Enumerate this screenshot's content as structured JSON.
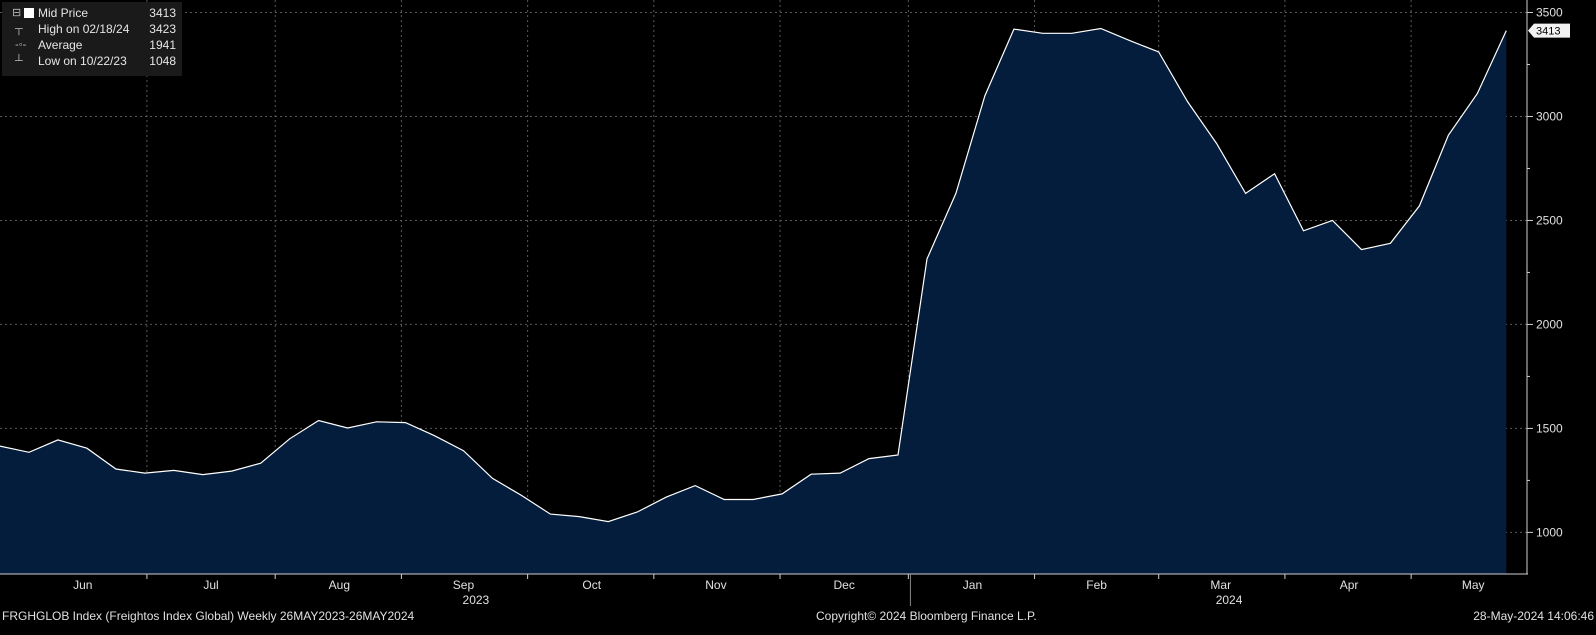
{
  "chart_data": {
    "type": "area",
    "title": "",
    "xlabel": "",
    "ylabel": "",
    "ylim": [
      800,
      3560
    ],
    "xlim": [
      "2023-05-26",
      "2024-05-29"
    ],
    "y_ticks": [
      1000,
      1500,
      2000,
      2500,
      3000,
      3500
    ],
    "x_ticks": [
      {
        "label": "Jun",
        "date": "2023-06-15"
      },
      {
        "label": "Jul",
        "date": "2023-07-16"
      },
      {
        "label": "Aug",
        "date": "2023-08-16"
      },
      {
        "label": "Sep",
        "date": "2023-09-15"
      },
      {
        "label": "Oct",
        "date": "2023-10-16"
      },
      {
        "label": "Nov",
        "date": "2023-11-15"
      },
      {
        "label": "Dec",
        "date": "2023-12-16"
      },
      {
        "label": "Jan",
        "date": "2024-01-16"
      },
      {
        "label": "Feb",
        "date": "2024-02-15"
      },
      {
        "label": "Mar",
        "date": "2024-03-16"
      },
      {
        "label": "Apr",
        "date": "2024-04-16"
      },
      {
        "label": "May",
        "date": "2024-05-16"
      }
    ],
    "year_labels": [
      {
        "label": "2023",
        "date": "2023-09-18"
      },
      {
        "label": "2024",
        "date": "2024-03-18"
      }
    ],
    "grid": true,
    "line_color": "#ffffff",
    "fill_color": "#041d3c",
    "series": [
      {
        "x": [
          "2023-05-26",
          "2023-06-02",
          "2023-06-09",
          "2023-06-16",
          "2023-06-23",
          "2023-06-30",
          "2023-07-07",
          "2023-07-14",
          "2023-07-21",
          "2023-07-28",
          "2023-08-04",
          "2023-08-11",
          "2023-08-18",
          "2023-08-25",
          "2023-09-01",
          "2023-09-08",
          "2023-09-15",
          "2023-09-22",
          "2023-09-29",
          "2023-10-06",
          "2023-10-13",
          "2023-10-20",
          "2023-10-27",
          "2023-11-03",
          "2023-11-10",
          "2023-11-17",
          "2023-11-24",
          "2023-12-01",
          "2023-12-08",
          "2023-12-15",
          "2023-12-22",
          "2023-12-29",
          "2024-01-05",
          "2024-01-12",
          "2024-01-19",
          "2024-01-26",
          "2024-02-02",
          "2024-02-09",
          "2024-02-16",
          "2024-02-23",
          "2024-03-01",
          "2024-03-08",
          "2024-03-15",
          "2024-03-22",
          "2024-03-29",
          "2024-04-05",
          "2024-04-12",
          "2024-04-19",
          "2024-04-26",
          "2024-05-03",
          "2024-05-10",
          "2024-05-17",
          "2024-05-24"
        ],
        "y": [
          1415,
          1385,
          1445,
          1405,
          1305,
          1285,
          1298,
          1278,
          1295,
          1333,
          1450,
          1538,
          1502,
          1532,
          1528,
          1465,
          1393,
          1260,
          1178,
          1088,
          1076,
          1052,
          1098,
          1170,
          1225,
          1158,
          1158,
          1185,
          1280,
          1285,
          1355,
          1372,
          2315,
          2630,
          3100,
          3420,
          3400,
          3400,
          3423,
          3365,
          3310,
          3070,
          2870,
          2630,
          2725,
          2450,
          2500,
          2360,
          2390,
          2570,
          2910,
          3110,
          3413
        ]
      }
    ],
    "last_value_label": "3413"
  },
  "legend": {
    "items": [
      {
        "label": "Mid Price",
        "value": "3413"
      },
      {
        "label": "High on 02/18/24",
        "value": "3423"
      },
      {
        "label": "Average",
        "value": "1941"
      },
      {
        "label": "Low on 10/22/23",
        "value": "1048"
      }
    ]
  },
  "footer": {
    "left": "FRGHGLOB Index (Freightos Index Global)  Weekly 26MAY2023-26MAY2024",
    "center": "Copyright© 2024 Bloomberg Finance L.P.",
    "right": "28-May-2024 14:06:46"
  }
}
